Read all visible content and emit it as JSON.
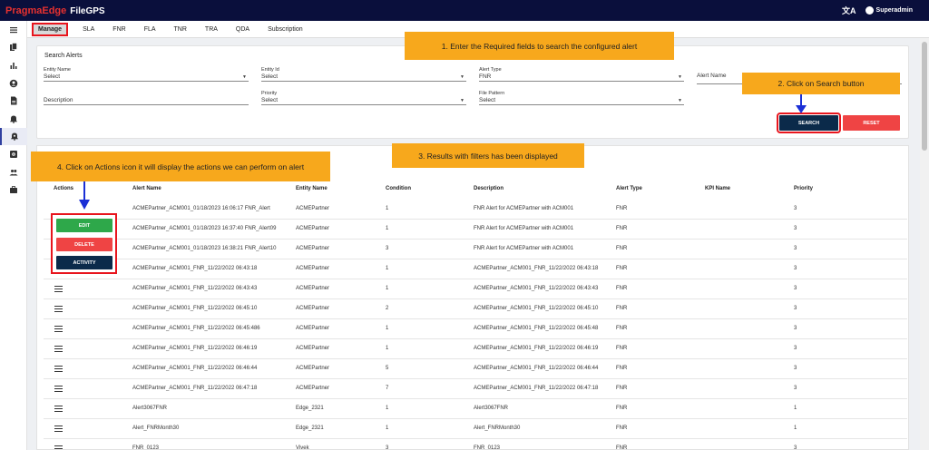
{
  "header": {
    "brand_pragma": "PragmaEdge",
    "brand_product": "FileGPS",
    "language_icon": "translate-icon",
    "user_name": "Superadmin",
    "colors": {
      "bar": "#0a0f3c",
      "brand_red": "#e8312f"
    }
  },
  "sidebar": {
    "icons": [
      "hamburger-menu-icon",
      "files-icon",
      "bar-chart-icon",
      "account-circle-icon",
      "document-icon",
      "bell-icon",
      "bell-settings-icon",
      "settings-box-icon",
      "group-icon",
      "briefcase-icon"
    ],
    "active_index": 6
  },
  "tabs": [
    "Manage",
    "SLA",
    "FNR",
    "FLA",
    "TNR",
    "TRA",
    "QDA",
    "Subscription"
  ],
  "search": {
    "title": "Search Alerts",
    "entity_name": {
      "label": "Entity Name",
      "value": "Select"
    },
    "entity_id": {
      "label": "Entity Id",
      "value": "Select"
    },
    "alert_type": {
      "label": "Alert Type",
      "value": "FNR"
    },
    "alert_name": {
      "label": "Alert Name",
      "value": ""
    },
    "description": {
      "label": "Description",
      "value": ""
    },
    "priority": {
      "label": "Priority",
      "value": "Select"
    },
    "file_pattern": {
      "label": "File Pattern",
      "value": "Select"
    },
    "search_button": "SEARCH",
    "reset_button": "RESET"
  },
  "callouts": {
    "c1": "1. Enter the Required fields to search the configured alert",
    "c2": "2. Click on Search button",
    "c3": "3. Results with filters has been displayed",
    "c4": "4. Click on Actions icon it will display the actions we can perform on alert"
  },
  "actions_popup": {
    "edit": "EDIT",
    "delete": "DELETE",
    "activity": "ACTIVITY"
  },
  "table": {
    "columns": [
      "Actions",
      "Alert Name",
      "Entity Name",
      "Condition",
      "Description",
      "Alert Type",
      "KPI Name",
      "Priority"
    ],
    "rows": [
      {
        "alert_name": "ACMEPartner_ACM001_01/18/2023 16:06:17 FNR_Alert",
        "entity": "ACMEPartner",
        "condition": "1",
        "description": "FNR Alert for ACMEPartner with ACM001",
        "type": "FNR",
        "kpi": "",
        "priority": "3"
      },
      {
        "alert_name": "ACMEPartner_ACM001_01/18/2023 16:37:40 FNR_Alert09",
        "entity": "ACMEPartner",
        "condition": "1",
        "description": "FNR Alert for ACMEPartner with ACM001",
        "type": "FNR",
        "kpi": "",
        "priority": "3"
      },
      {
        "alert_name": "ACMEPartner_ACM001_01/18/2023 16:38:21 FNR_Alert10",
        "entity": "ACMEPartner",
        "condition": "3",
        "description": "FNR Alert for ACMEPartner with ACM001",
        "type": "FNR",
        "kpi": "",
        "priority": "3"
      },
      {
        "alert_name": "ACMEPartner_ACM001_FNR_11/22/2022 06:43:18",
        "entity": "ACMEPartner",
        "condition": "1",
        "description": "ACMEPartner_ACM001_FNR_11/22/2022 06:43:18",
        "type": "FNR",
        "kpi": "",
        "priority": "3"
      },
      {
        "alert_name": "ACMEPartner_ACM001_FNR_11/22/2022 06:43:43",
        "entity": "ACMEPartner",
        "condition": "1",
        "description": "ACMEPartner_ACM001_FNR_11/22/2022 06:43:43",
        "type": "FNR",
        "kpi": "",
        "priority": "3"
      },
      {
        "alert_name": "ACMEPartner_ACM001_FNR_11/22/2022 06:45:10",
        "entity": "ACMEPartner",
        "condition": "2",
        "description": "ACMEPartner_ACM001_FNR_11/22/2022 06:45:10",
        "type": "FNR",
        "kpi": "",
        "priority": "3"
      },
      {
        "alert_name": "ACMEPartner_ACM001_FNR_11/22/2022 06:45:486",
        "entity": "ACMEPartner",
        "condition": "1",
        "description": "ACMEPartner_ACM001_FNR_11/22/2022 06:45:48",
        "type": "FNR",
        "kpi": "",
        "priority": "3"
      },
      {
        "alert_name": "ACMEPartner_ACM001_FNR_11/22/2022 06:46:19",
        "entity": "ACMEPartner",
        "condition": "1",
        "description": "ACMEPartner_ACM001_FNR_11/22/2022 06:46:19",
        "type": "FNR",
        "kpi": "",
        "priority": "3"
      },
      {
        "alert_name": "ACMEPartner_ACM001_FNR_11/22/2022 06:46:44",
        "entity": "ACMEPartner",
        "condition": "5",
        "description": "ACMEPartner_ACM001_FNR_11/22/2022 06:46:44",
        "type": "FNR",
        "kpi": "",
        "priority": "3"
      },
      {
        "alert_name": "ACMEPartner_ACM001_FNR_11/22/2022 06:47:18",
        "entity": "ACMEPartner",
        "condition": "7",
        "description": "ACMEPartner_ACM001_FNR_11/22/2022 06:47:18",
        "type": "FNR",
        "kpi": "",
        "priority": "3"
      },
      {
        "alert_name": "Alert3067FNR",
        "entity": "Edge_2321",
        "condition": "1",
        "description": "Alert3067FNR",
        "type": "FNR",
        "kpi": "",
        "priority": "1"
      },
      {
        "alert_name": "Alert_FNRMonth30",
        "entity": "Edge_2321",
        "condition": "1",
        "description": "Alert_FNRMonth30",
        "type": "FNR",
        "kpi": "",
        "priority": "1"
      },
      {
        "alert_name": "FNR_0123",
        "entity": "Vivek",
        "condition": "3",
        "description": "FNR_0123",
        "type": "FNR",
        "kpi": "",
        "priority": "3"
      }
    ]
  }
}
